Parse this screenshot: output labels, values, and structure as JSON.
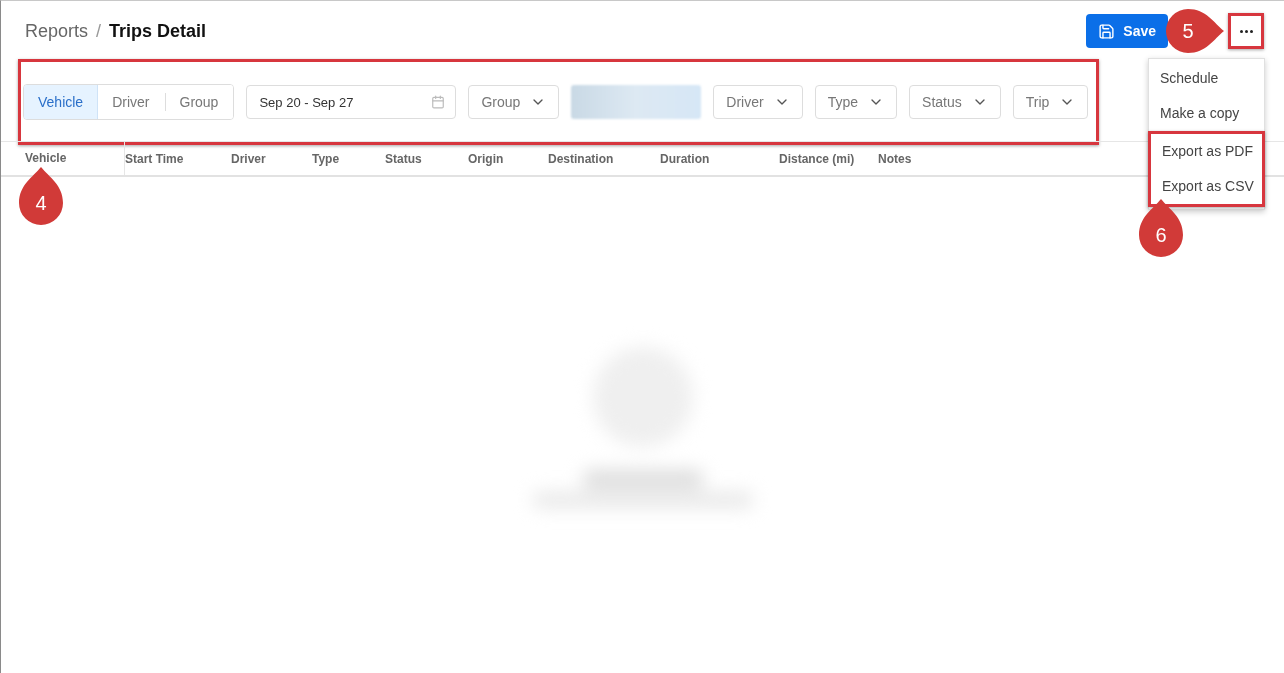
{
  "breadcrumb_separator": "/",
  "breadcrumb": [
    {
      "label": "Reports",
      "current": false
    },
    {
      "label": "Trips Detail",
      "current": true
    }
  ],
  "save_label": "Save",
  "menu": [
    {
      "label": "Schedule"
    },
    {
      "label": "Make a copy"
    },
    {
      "label": "Export as PDF"
    },
    {
      "label": "Export as CSV"
    }
  ],
  "view_toggle": [
    {
      "label": "Vehicle",
      "selected": true
    },
    {
      "label": "Driver",
      "selected": false
    },
    {
      "label": "Group",
      "selected": false
    }
  ],
  "date_range": "Sep 20 - Sep 27",
  "filters": [
    {
      "kind": "select",
      "label": "Group"
    },
    {
      "kind": "redacted"
    },
    {
      "kind": "select",
      "label": "Driver"
    },
    {
      "kind": "select",
      "label": "Type"
    },
    {
      "kind": "select",
      "label": "Status"
    },
    {
      "kind": "select",
      "label": "Trip"
    }
  ],
  "columns": [
    "Vehicle",
    "Start Time",
    "Driver",
    "Type",
    "Status",
    "Origin",
    "Destination",
    "Duration",
    "Distance (mi)",
    "Notes"
  ],
  "callouts": [
    {
      "label": "4"
    },
    {
      "label": "5"
    },
    {
      "label": "6"
    }
  ]
}
